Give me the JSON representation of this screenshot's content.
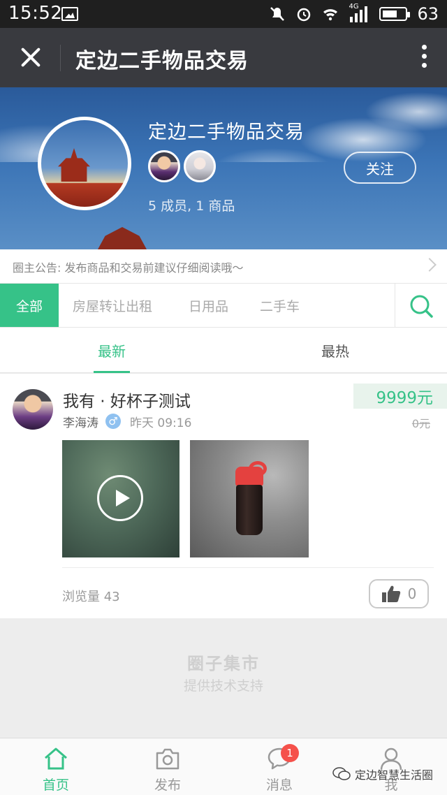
{
  "status_bar": {
    "time": "15:52",
    "network": "4G",
    "battery": "63"
  },
  "titlebar": {
    "title": "定边二手物品交易"
  },
  "group": {
    "name": "定边二手物品交易",
    "stats": "5 成员, 1 商品",
    "follow_label": "关注"
  },
  "notice": {
    "text": "圈主公告: 发布商品和交易前建议仔细阅读哦～"
  },
  "categories": [
    {
      "label": "全部"
    },
    {
      "label": "房屋转让出租"
    },
    {
      "label": "日用品"
    },
    {
      "label": "二手车"
    }
  ],
  "sort_tabs": [
    {
      "label": "最新"
    },
    {
      "label": "最热"
    }
  ],
  "post": {
    "title": "我有 · 好杯子测试",
    "author": "李海涛",
    "gender_symbol": "♂",
    "time": "昨天 09:16",
    "price": "9999元",
    "original_price": "0元",
    "views": "浏览量 43",
    "likes": "0"
  },
  "footer": {
    "brand": "圈子集市",
    "support": "提供技术支持"
  },
  "bottom_nav": [
    {
      "label": "首页"
    },
    {
      "label": "发布"
    },
    {
      "label": "消息"
    },
    {
      "label": "我"
    }
  ],
  "message_badge": "1",
  "watermark": "定边智慧生活圈",
  "colors": {
    "accent": "#36c288",
    "titlebar": "#393a3f",
    "badge": "#f5514b"
  }
}
